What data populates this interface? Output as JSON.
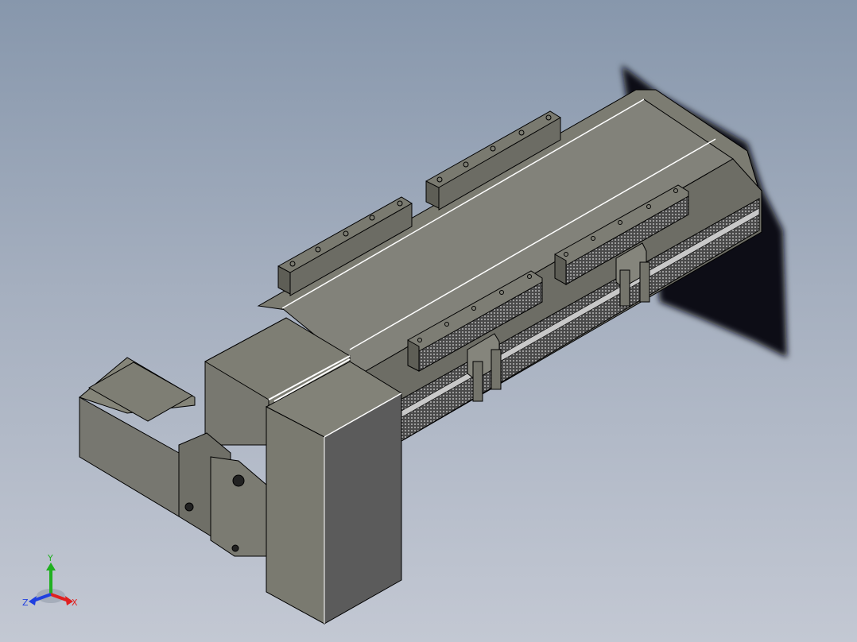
{
  "viewport": {
    "background_top": "#8797ac",
    "background_bottom": "#c3c8d3"
  },
  "model": {
    "body_color": "#7a7a6f",
    "highlight_color": "#ffffff",
    "shadow_color": "#0e0e12"
  },
  "triad": {
    "x_label": "X",
    "y_label": "Y",
    "z_label": "Z",
    "x_color": "#e02020",
    "y_color": "#20b020",
    "z_color": "#2040e0"
  }
}
